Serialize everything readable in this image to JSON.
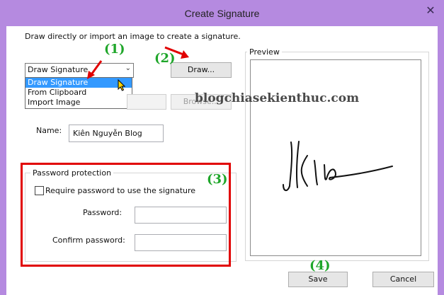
{
  "window": {
    "title": "Create Signature",
    "close_glyph": "✕"
  },
  "intro_text": "Draw directly or import an image to create a signature.",
  "source_select": {
    "value": "Draw Signature",
    "options": [
      "Draw Signature",
      "From Clipboard",
      "Import Image"
    ]
  },
  "draw_button_label": "Draw...",
  "browse_button_label": "Browse...",
  "name_label": "Name:",
  "name_value": "Kiên Nguyễn Blog",
  "password_group": {
    "legend": "Password protection",
    "require_label": "Require password to use the signature",
    "require_checked": false,
    "password_label": "Password:",
    "confirm_label": "Confirm password:"
  },
  "preview_label": "Preview",
  "save_label": "Save",
  "cancel_label": "Cancel",
  "annotations": {
    "marker1": "(1)",
    "marker2": "(2)",
    "marker3": "(3)",
    "marker4": "(4)",
    "color_marker": "#1fa62a",
    "color_arrow": "#e10000"
  },
  "watermark": "blogchiasekienthuc.com",
  "colors": {
    "frame": "#b58ae0",
    "highlight": "#3399ff",
    "annotation_box": "#e10000"
  }
}
